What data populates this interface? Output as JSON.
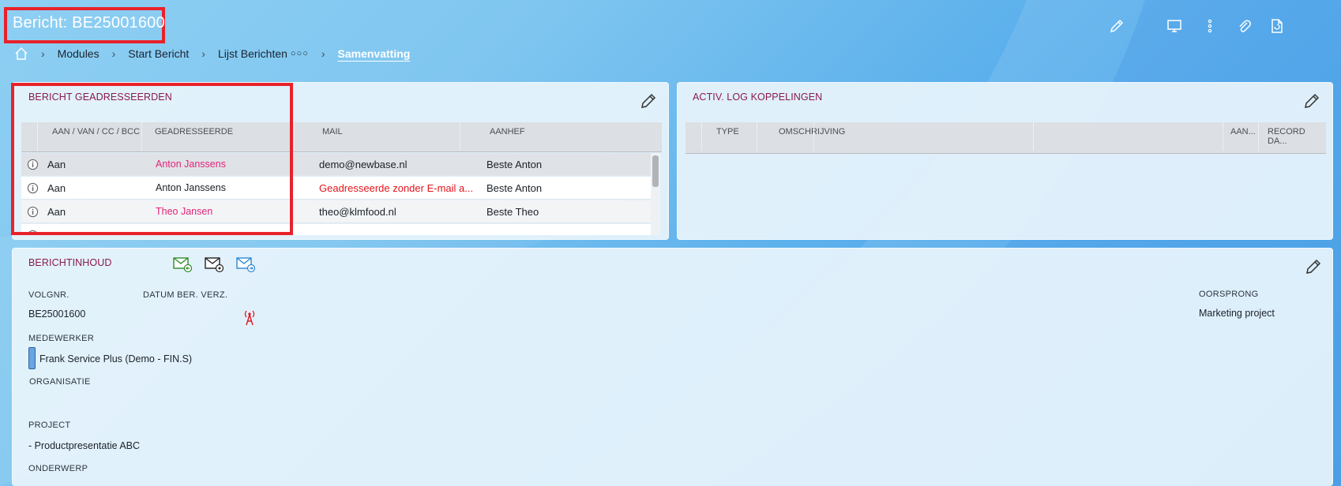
{
  "header": {
    "title": "Bericht: BE25001600",
    "icons": [
      "pencil-icon",
      "monitor-icon",
      "more-vertical-icon",
      "paperclip-icon",
      "document-refresh-icon"
    ]
  },
  "breadcrumb": {
    "home_icon": "home-icon",
    "items": [
      "Modules",
      "Start Bericht",
      "Lijst Berichten",
      "Samenvatting"
    ],
    "more_glyph": "○○○"
  },
  "addressees_panel": {
    "title": "BERICHT GEADRESSEERDEN",
    "columns": [
      "AAN / VAN / CC / BCC",
      "GEADRESSEERDE",
      "MAIL",
      "AANHEF"
    ],
    "rows": [
      {
        "type": "Aan",
        "addressee": "Anton Janssens",
        "mail": "demo@newbase.nl",
        "salutation": "Beste Anton"
      },
      {
        "type": "Aan",
        "addressee": "Anton Janssens",
        "mail": "Geadresseerde zonder E-mail a...",
        "salutation": "Beste Anton"
      },
      {
        "type": "Aan",
        "addressee": "Theo Jansen",
        "mail": "theo@klmfood.nl",
        "salutation": "Beste Theo"
      }
    ]
  },
  "activity_panel": {
    "title": "ACTIV. LOG KOPPELINGEN",
    "columns": [
      "TYPE",
      "OMSCHRIJVING",
      "AAN...",
      "RECORD DA..."
    ]
  },
  "content_panel": {
    "title": "BERICHTINHOUD",
    "mail_icons": [
      "mail-receive-icon",
      "mail-settings-icon",
      "mail-send-icon"
    ],
    "fields": {
      "volgnr_label": "VOLGNR.",
      "volgnr_value": "BE25001600",
      "datum_label": "DATUM BER. VERZ.",
      "medewerker_label": "MEDEWERKER",
      "medewerker_value": "Frank Service Plus (Demo - FIN.S)",
      "organisatie_label": "ORGANISATIE",
      "project_label": "PROJECT",
      "project_value": "- Productpresentatie ABC",
      "onderwerp_label": "ONDERWERP",
      "oorsprong_label": "OORSPRONG",
      "oorsprong_value": "Marketing project"
    }
  },
  "colors": {
    "accent_title": "#8a1a4a",
    "link_pink": "#e3247a",
    "error_red": "#e3151c",
    "highlight_box": "#e8222a"
  }
}
